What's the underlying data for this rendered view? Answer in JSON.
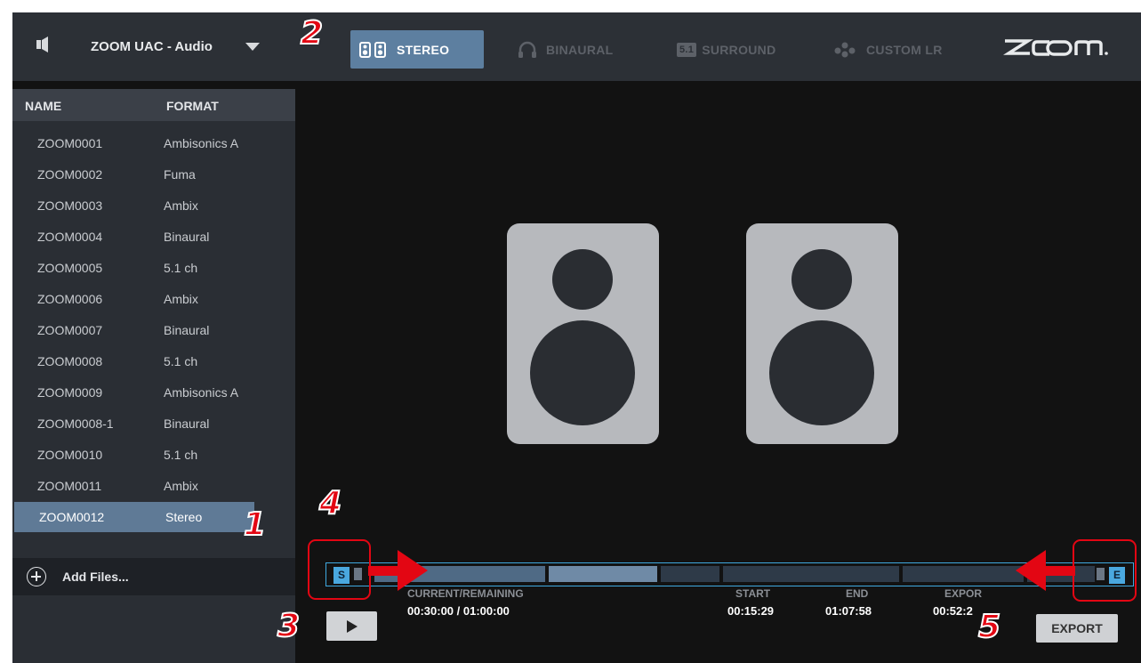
{
  "topbar": {
    "device": "ZOOM UAC - Audio",
    "modes": [
      {
        "label": "STEREO",
        "active": true
      },
      {
        "label": "BINAURAL",
        "active": false
      },
      {
        "label": "SURROUND",
        "badge": "5.1",
        "active": false
      },
      {
        "label": "CUSTOM LR",
        "active": false
      }
    ],
    "logo_alt": "ZOOM"
  },
  "file_list": {
    "headers": {
      "name": "NAME",
      "format": "FORMAT"
    },
    "rows": [
      {
        "name": "ZOOM0001",
        "format": "Ambisonics A"
      },
      {
        "name": "ZOOM0002",
        "format": "Fuma"
      },
      {
        "name": "ZOOM0003",
        "format": "Ambix"
      },
      {
        "name": "ZOOM0004",
        "format": "Binaural"
      },
      {
        "name": "ZOOM0005",
        "format": "5.1 ch"
      },
      {
        "name": "ZOOM0006",
        "format": "Ambix"
      },
      {
        "name": "ZOOM0007",
        "format": "Binaural"
      },
      {
        "name": "ZOOM0008",
        "format": "5.1 ch"
      },
      {
        "name": "ZOOM0009",
        "format": "Ambisonics A"
      },
      {
        "name": "ZOOM0008-1",
        "format": "Binaural"
      },
      {
        "name": "ZOOM0010",
        "format": "5.1 ch"
      },
      {
        "name": "ZOOM0011",
        "format": "Ambix"
      },
      {
        "name": "ZOOM0012",
        "format": "Stereo",
        "selected": true
      }
    ],
    "add_label": "Add Files..."
  },
  "timeline": {
    "start_marker": "S",
    "end_marker": "E"
  },
  "transport": {
    "current_label": "CURRENT/REMAINING",
    "current_value": "00:30:00 / 01:00:00",
    "start_label": "START",
    "start_value": "00:15:29",
    "end_label": "END",
    "end_value": "01:07:58",
    "export_label": "EXPOR",
    "export_value": "00:52:2",
    "export_button": "EXPORT"
  },
  "annotations": [
    "1",
    "2",
    "3",
    "4",
    "5"
  ],
  "colors": {
    "accent": "#5d7fa0",
    "timeline_border": "#3fa9e0",
    "callout": "#e30613"
  }
}
